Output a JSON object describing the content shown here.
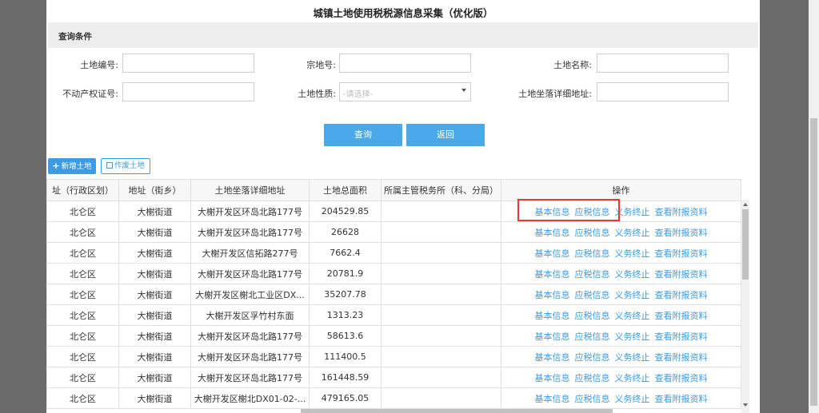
{
  "page_title": "城镇土地使用税税源信息采集（优化版）",
  "query_section": {
    "title": "查询条件"
  },
  "form": {
    "land_no_label": "土地编号:",
    "parcel_no_label": "宗地号:",
    "land_name_label": "土地名称:",
    "property_cert_label": "不动产权证号:",
    "land_nature_label": "土地性质:",
    "land_nature_placeholder": "-请选择-",
    "address_detail_label": "土地坐落详细地址:"
  },
  "buttons": {
    "query": "查询",
    "back": "返回"
  },
  "toolbar": {
    "add_label": "新增土地",
    "void_label": "作废土地"
  },
  "table": {
    "headers": [
      "址（行政区划）",
      "地址（街乡）",
      "土地坐落详细地址",
      "土地总面积",
      "所属主管税务所（科、分局）",
      "操作"
    ],
    "action_labels": [
      "基本信息",
      "应税信息",
      "义务终止",
      "查看附报资料"
    ],
    "rows": [
      [
        "北仑区",
        "大榭街道",
        "大榭开发区环岛北路177号",
        "204529.85",
        ""
      ],
      [
        "北仑区",
        "大榭街道",
        "大榭开发区环岛北路177号",
        "26628",
        ""
      ],
      [
        "北仑区",
        "大榭街道",
        "大榭开发区信拓路277号",
        "7662.4",
        ""
      ],
      [
        "北仑区",
        "大榭街道",
        "大榭开发区环岛北路177号",
        "20781.9",
        ""
      ],
      [
        "北仑区",
        "大榭街道",
        "大榭开发区榭北工业区DX...",
        "35207.78",
        ""
      ],
      [
        "北仑区",
        "大榭街道",
        "大榭开发区孚竹村东面",
        "1313.23",
        ""
      ],
      [
        "北仑区",
        "大榭街道",
        "大榭开发区环岛北路177号",
        "58613.6",
        ""
      ],
      [
        "北仑区",
        "大榭街道",
        "大榭开发区环岛北路177号",
        "111400.5",
        ""
      ],
      [
        "北仑区",
        "大榭街道",
        "大榭开发区环岛北路177号",
        "161448.59",
        ""
      ],
      [
        "北仑区",
        "大榭街道",
        "大榭开发区榭北DX01-02-...",
        "479165.05",
        ""
      ]
    ]
  }
}
